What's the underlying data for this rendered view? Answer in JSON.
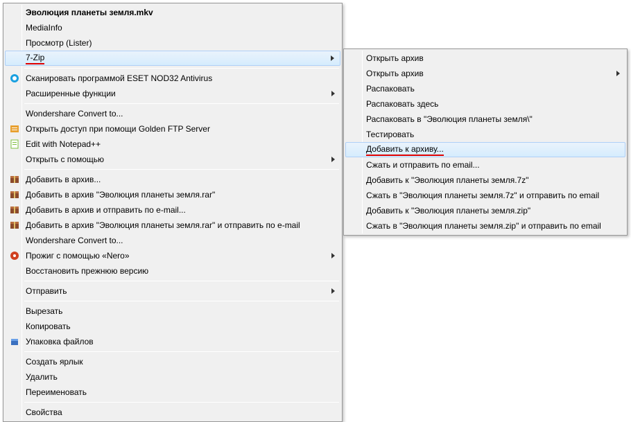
{
  "main_menu": {
    "title": "Эволюция планеты земля.mkv",
    "items": [
      {
        "label": "MediaInfo"
      },
      {
        "label": "Просмотр (Lister)"
      },
      {
        "label": "7-Zip",
        "submenu": true,
        "highlighted": true,
        "underlined": true
      },
      "---",
      {
        "label": "Сканировать программой ESET NOD32 Antivirus",
        "icon": "eset-icon"
      },
      {
        "label": "Расширенные функции",
        "submenu": true
      },
      "---",
      {
        "label": "Wondershare Convert to..."
      },
      {
        "label": "Открыть доступ при помощи Golden FTP Server",
        "icon": "ftp-icon"
      },
      {
        "label": "Edit with Notepad++",
        "icon": "notepad-icon"
      },
      {
        "label": "Открыть с помощью",
        "submenu": true
      },
      "---",
      {
        "label": "Добавить в архив...",
        "icon": "winrar-icon"
      },
      {
        "label": "Добавить в архив \"Эволюция планеты земля.rar\"",
        "icon": "winrar-icon"
      },
      {
        "label": "Добавить в архив и отправить по e-mail...",
        "icon": "winrar-icon"
      },
      {
        "label": "Добавить в архив \"Эволюция планеты земля.rar\" и отправить по e-mail",
        "icon": "winrar-icon"
      },
      {
        "label": "Wondershare Convert to..."
      },
      {
        "label": "Прожиг с помощью «Nero»",
        "icon": "nero-icon",
        "submenu": true
      },
      {
        "label": "Восстановить прежнюю версию"
      },
      "---",
      {
        "label": "Отправить",
        "submenu": true
      },
      "---",
      {
        "label": "Вырезать"
      },
      {
        "label": "Копировать"
      },
      {
        "label": "Упаковка файлов",
        "icon": "pack-icon"
      },
      "---",
      {
        "label": "Создать ярлык"
      },
      {
        "label": "Удалить"
      },
      {
        "label": "Переименовать"
      },
      "---",
      {
        "label": "Свойства"
      }
    ]
  },
  "sub_menu": {
    "items": [
      {
        "label": "Открыть архив"
      },
      {
        "label": "Открыть архив",
        "submenu": true
      },
      {
        "label": "Распаковать"
      },
      {
        "label": "Распаковать здесь"
      },
      {
        "label": "Распаковать в \"Эволюция планеты земля\\\""
      },
      {
        "label": "Тестировать"
      },
      {
        "label": "Добавить к архиву...",
        "highlighted": true,
        "underlined": true
      },
      {
        "label": "Сжать и отправить по email..."
      },
      {
        "label": "Добавить к \"Эволюция планеты земля.7z\""
      },
      {
        "label": "Сжать в \"Эволюция планеты земля.7z\" и отправить по email"
      },
      {
        "label": "Добавить к \"Эволюция планеты земля.zip\""
      },
      {
        "label": "Сжать в \"Эволюция планеты земля.zip\" и отправить по email"
      }
    ]
  },
  "icons": {
    "eset-icon": "#1aa0e0",
    "ftp-icon": "#e8a030",
    "notepad-icon": "#7fbf3f",
    "winrar-icon": "#8b4a2b",
    "nero-icon": "#d04020",
    "pack-icon": "#3a70c0"
  }
}
